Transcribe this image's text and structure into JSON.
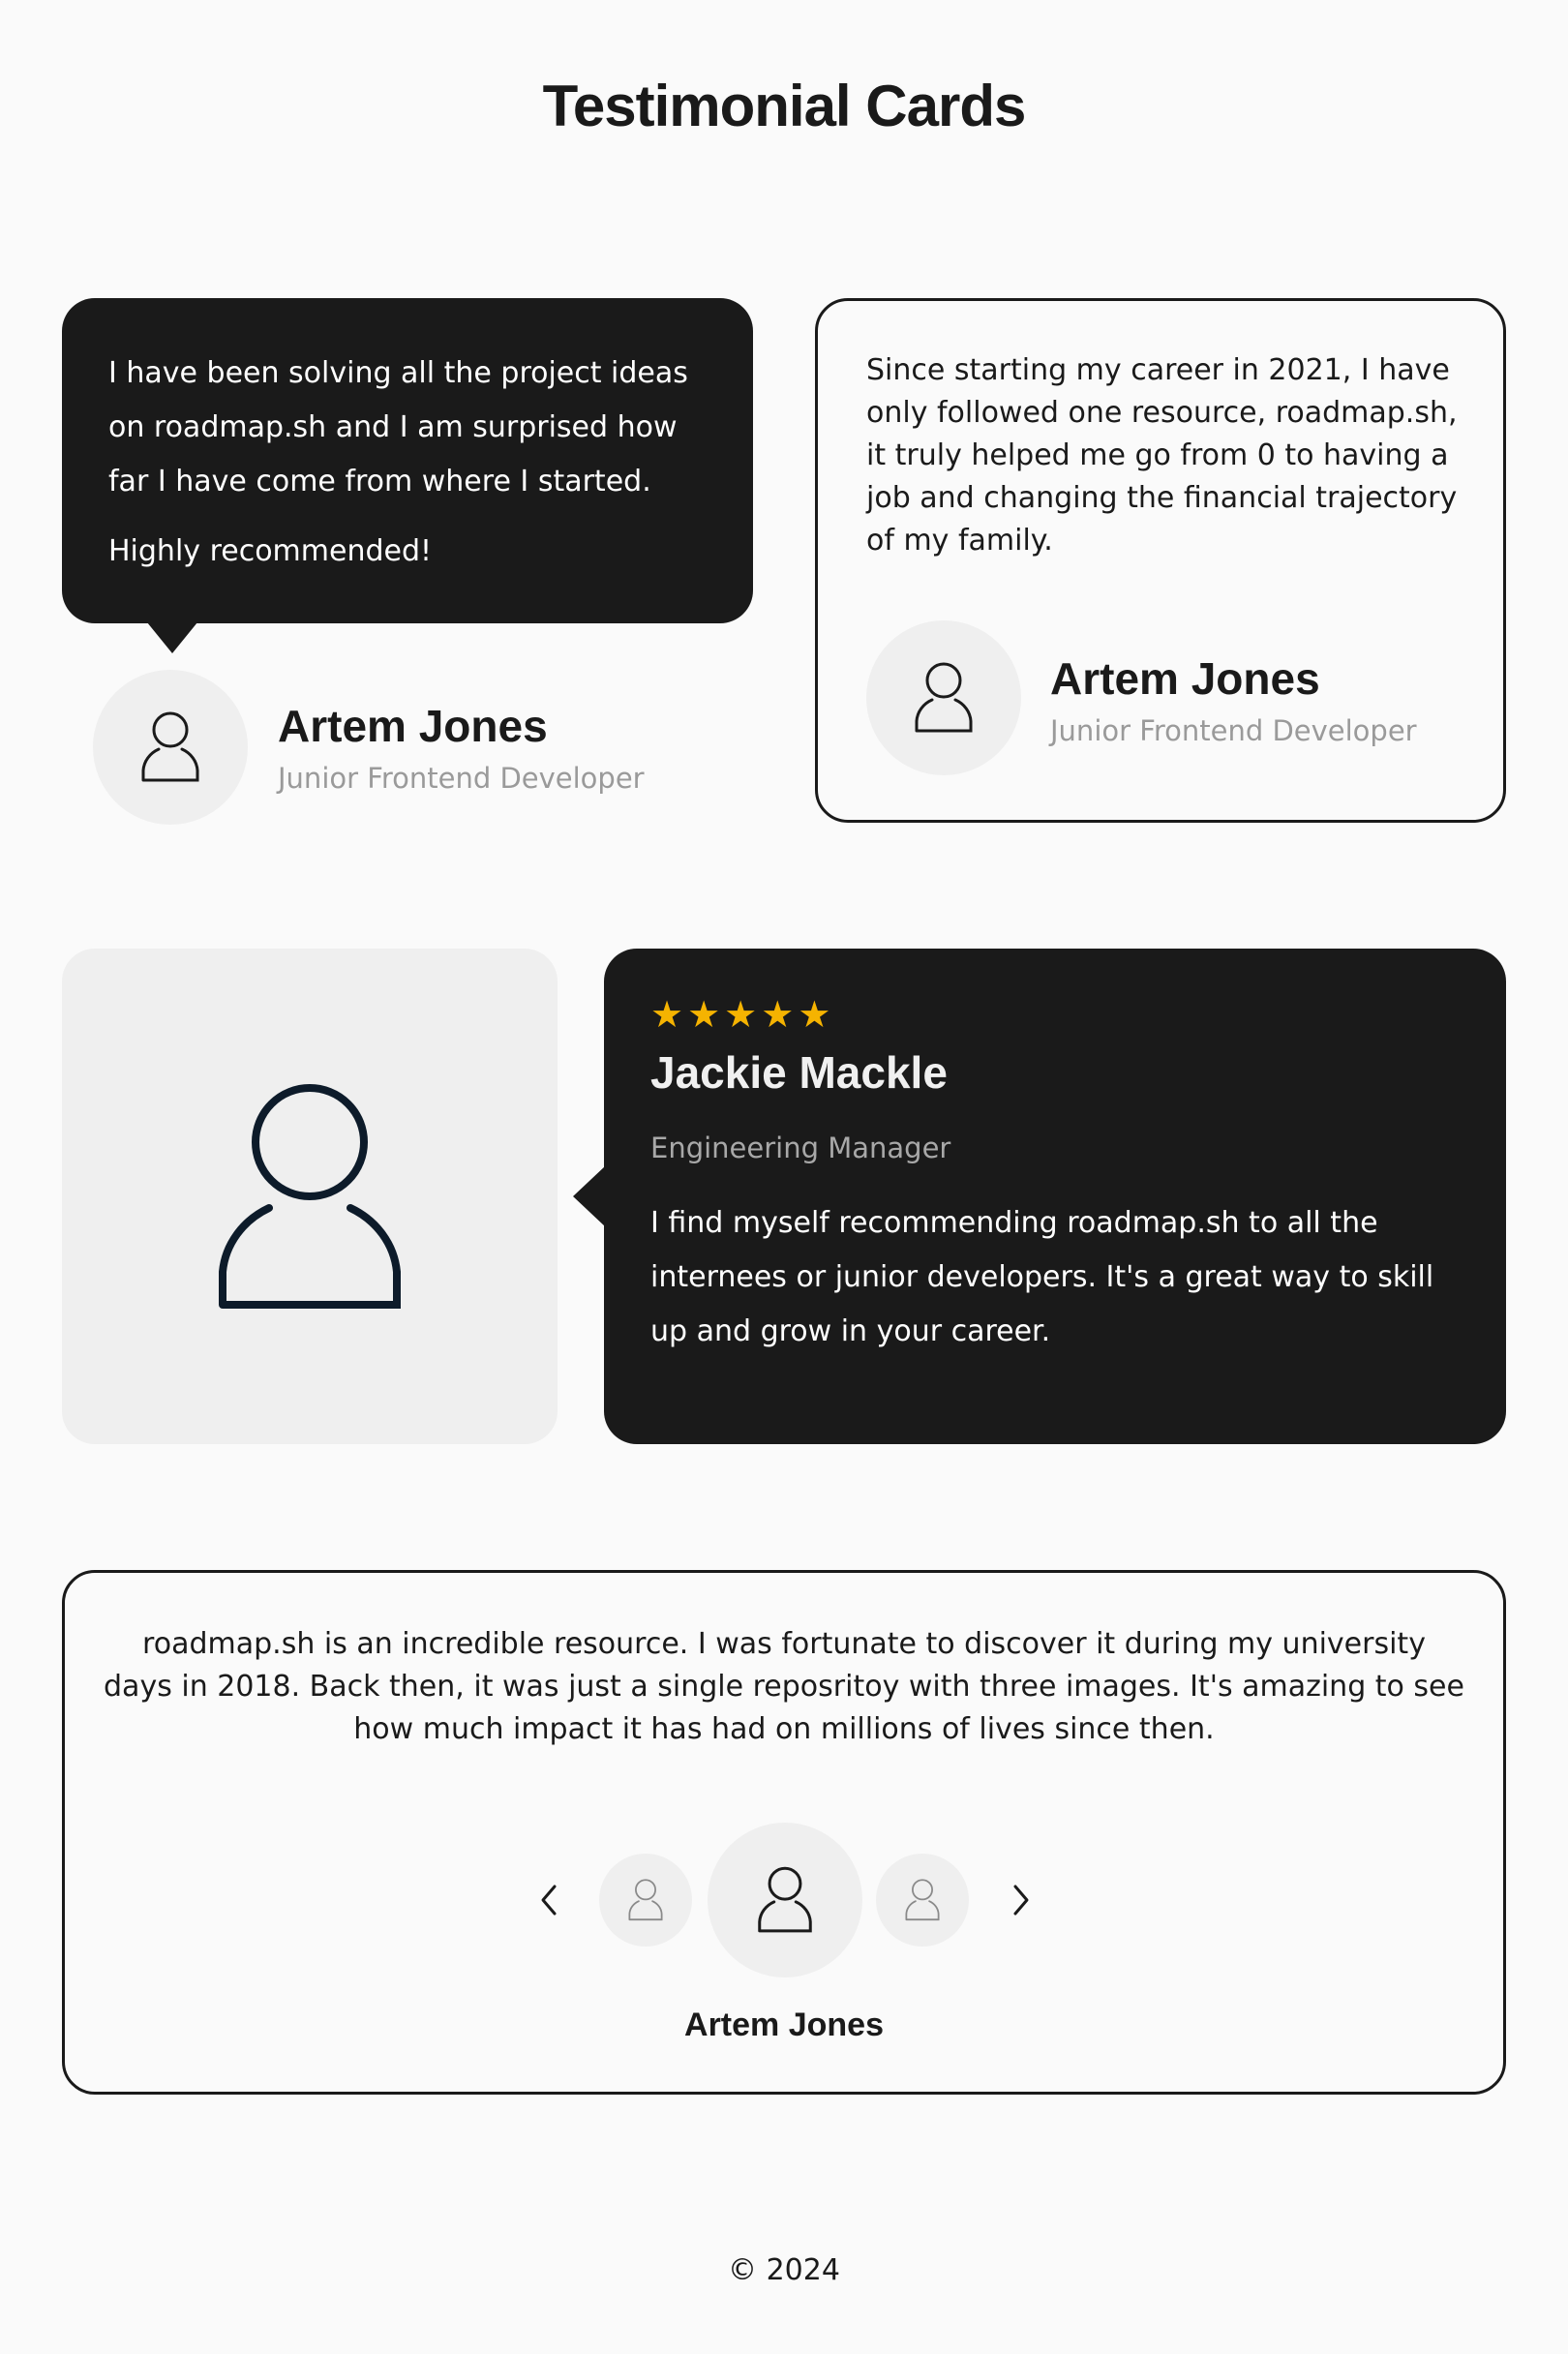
{
  "page": {
    "title": "Testimonial Cards"
  },
  "card_bubble": {
    "paragraph_1": "I have been solving all the project ideas on roadmap.sh and I am surprised how far I have come from where I started.",
    "paragraph_2": "Highly recommended!",
    "name": "Artem Jones",
    "role": "Junior Frontend Developer",
    "avatar_icon": "user-icon"
  },
  "card_outlined": {
    "quote": "Since starting my career in 2021, I have only followed one resource, roadmap.sh, it truly helped me go from 0 to having a job and changing the financial trajectory of my family.",
    "name": "Artem Jones",
    "role": "Junior Frontend Developer",
    "avatar_icon": "user-icon"
  },
  "card_featured": {
    "stars": [
      "★",
      "★",
      "★",
      "★",
      "★"
    ],
    "rating": 5,
    "star_color": "#f5b301",
    "name": "Jackie Mackle",
    "role": "Engineering Manager",
    "quote": "I find myself recommending roadmap.sh to all the internees or junior developers. It's a great way to skill up and grow in your career.",
    "photo_icon": "user-icon"
  },
  "card_carousel": {
    "quote": "roadmap.sh is an incredible resource. I was fortunate to discover it during my university days in 2018. Back then, it was just a single reposritoy with three images. It's amazing to see how much impact it has had on millions of lives since then.",
    "name": "Artem Jones",
    "prev_icon": "chevron-left-icon",
    "next_icon": "chevron-right-icon"
  },
  "footer": {
    "copyright": "© 2024"
  },
  "colors": {
    "dark": "#1a1a1a",
    "background": "#fafafa",
    "avatar_bg": "#efefef",
    "muted_text": "#9a9a9a",
    "star": "#f5b301"
  }
}
